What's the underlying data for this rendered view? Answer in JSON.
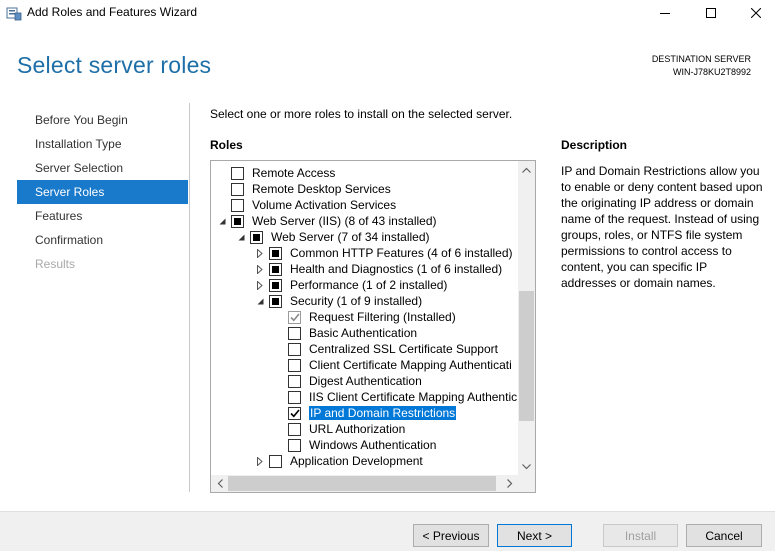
{
  "window": {
    "title": "Add Roles and Features Wizard"
  },
  "header": {
    "page_title": "Select server roles",
    "destination_label": "DESTINATION SERVER",
    "destination_server": "WIN-J78KU2T8992"
  },
  "nav": {
    "items": [
      {
        "label": "Before You Begin",
        "state": "normal"
      },
      {
        "label": "Installation Type",
        "state": "normal"
      },
      {
        "label": "Server Selection",
        "state": "normal"
      },
      {
        "label": "Server Roles",
        "state": "active"
      },
      {
        "label": "Features",
        "state": "normal"
      },
      {
        "label": "Confirmation",
        "state": "normal"
      },
      {
        "label": "Results",
        "state": "disabled"
      }
    ]
  },
  "main": {
    "instructions": "Select one or more roles to install on the selected server.",
    "roles_heading": "Roles",
    "description_heading": "Description",
    "description_text": "IP and Domain Restrictions allow you to enable or deny content based upon the originating IP address or domain name of the request. Instead of using groups, roles, or NTFS file system permissions to control access to content, you can specific IP addresses or domain names."
  },
  "roles": [
    {
      "label": "Remote Access",
      "indent": 0,
      "expander": "none",
      "check": "unchecked",
      "selected": false
    },
    {
      "label": "Remote Desktop Services",
      "indent": 0,
      "expander": "none",
      "check": "unchecked",
      "selected": false
    },
    {
      "label": "Volume Activation Services",
      "indent": 0,
      "expander": "none",
      "check": "unchecked",
      "selected": false
    },
    {
      "label": "Web Server (IIS) (8 of 43 installed)",
      "indent": 0,
      "expander": "expanded",
      "check": "partial",
      "selected": false
    },
    {
      "label": "Web Server (7 of 34 installed)",
      "indent": 1,
      "expander": "expanded",
      "check": "partial",
      "selected": false
    },
    {
      "label": "Common HTTP Features (4 of 6 installed)",
      "indent": 2,
      "expander": "collapsed",
      "check": "partial",
      "selected": false
    },
    {
      "label": "Health and Diagnostics (1 of 6 installed)",
      "indent": 2,
      "expander": "collapsed",
      "check": "partial",
      "selected": false
    },
    {
      "label": "Performance (1 of 2 installed)",
      "indent": 2,
      "expander": "collapsed",
      "check": "partial",
      "selected": false
    },
    {
      "label": "Security (1 of 9 installed)",
      "indent": 2,
      "expander": "expanded",
      "check": "partial",
      "selected": false
    },
    {
      "label": "Request Filtering (Installed)",
      "indent": 3,
      "expander": "none",
      "check": "checked-disabled",
      "selected": false
    },
    {
      "label": "Basic Authentication",
      "indent": 3,
      "expander": "none",
      "check": "unchecked",
      "selected": false
    },
    {
      "label": "Centralized SSL Certificate Support",
      "indent": 3,
      "expander": "none",
      "check": "unchecked",
      "selected": false
    },
    {
      "label": "Client Certificate Mapping Authenticati",
      "indent": 3,
      "expander": "none",
      "check": "unchecked",
      "selected": false
    },
    {
      "label": "Digest Authentication",
      "indent": 3,
      "expander": "none",
      "check": "unchecked",
      "selected": false
    },
    {
      "label": "IIS Client Certificate Mapping Authentic",
      "indent": 3,
      "expander": "none",
      "check": "unchecked",
      "selected": false
    },
    {
      "label": "IP and Domain Restrictions",
      "indent": 3,
      "expander": "none",
      "check": "checked",
      "selected": true
    },
    {
      "label": "URL Authorization",
      "indent": 3,
      "expander": "none",
      "check": "unchecked",
      "selected": false
    },
    {
      "label": "Windows Authentication",
      "indent": 3,
      "expander": "none",
      "check": "unchecked",
      "selected": false
    },
    {
      "label": "Application Development",
      "indent": 2,
      "expander": "collapsed",
      "check": "unchecked",
      "selected": false
    }
  ],
  "footer": {
    "previous_label": "< Previous",
    "next_label": "Next >",
    "install_label": "Install",
    "cancel_label": "Cancel"
  }
}
